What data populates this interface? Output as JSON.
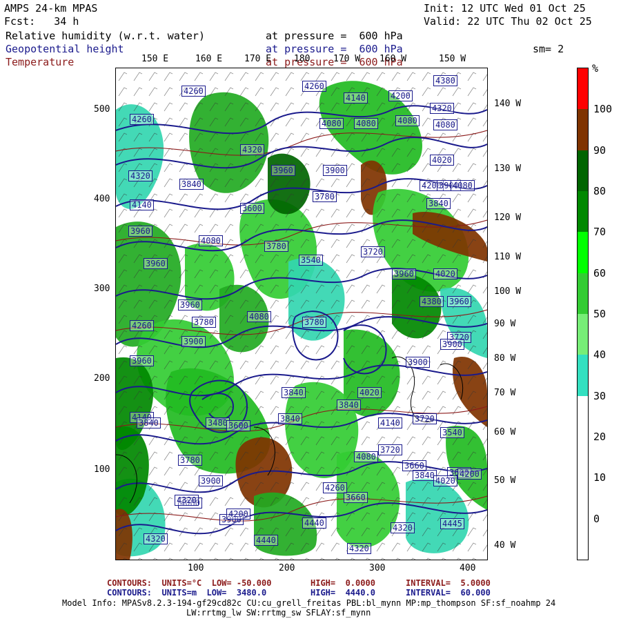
{
  "header": {
    "model": "AMPS 24-km MPAS",
    "init": "Init: 12 UTC Wed 01 Oct 25",
    "fcst": "Fcst:   34 h",
    "valid": "Valid: 22 UTC Thu 02 Oct 25",
    "field1": "Relative humidity (w.r.t. water)",
    "field1_level": "at pressure =  600 hPa",
    "field2": "Geopotential height",
    "field2_level": "at pressure =  600 hPa",
    "smoothing": "sm= 2",
    "field3": "Temperature",
    "field3_level": "at pressure =  600 hPa"
  },
  "map": {
    "top_lon_labels": [
      "150 E",
      "160 E",
      "170 E",
      "180",
      "170 W",
      "160 W",
      "150 W"
    ],
    "right_lon_labels": [
      "140 W",
      "130 W",
      "120 W",
      "110 W",
      "100 W",
      "90 W",
      "80 W",
      "70 W",
      "60 W",
      "50 W",
      "40 W"
    ],
    "left_grid_labels": [
      "500",
      "400",
      "300",
      "200",
      "100"
    ],
    "bottom_grid_labels": [
      "100",
      "200",
      "300",
      "400"
    ],
    "height_labels": [
      "4260",
      "4260",
      "4140",
      "4200",
      "4320",
      "4380",
      "4260",
      "4080",
      "4080",
      "4080",
      "4080",
      "4320",
      "4320",
      "4020",
      "4200",
      "3900",
      "3840",
      "3960",
      "3900",
      "3780",
      "4140",
      "3600",
      "3780",
      "3720",
      "3840",
      "4080",
      "3960",
      "3960",
      "3720",
      "4020",
      "3960",
      "4080",
      "3900",
      "3960",
      "3900",
      "3480",
      "3600",
      "3840",
      "4020",
      "3720",
      "3540",
      "3840",
      "3960",
      "3780",
      "4080",
      "3660",
      "3600",
      "3540",
      "4260",
      "3900",
      "3780",
      "3900",
      "3720",
      "3840",
      "3780",
      "3660",
      "3900",
      "4080",
      "3960",
      "4140",
      "3840",
      "4080",
      "4380",
      "4200",
      "4020",
      "4140",
      "4320",
      "4200",
      "4260",
      "4320",
      "4440",
      "4440",
      "4320",
      "4320",
      "4445",
      "3840"
    ]
  },
  "colorbar": {
    "unit": "%",
    "labels": [
      "100",
      "90",
      "80",
      "70",
      "60",
      "50",
      "40",
      "30",
      "20",
      "10",
      "0"
    ],
    "colors": [
      "#ff0000",
      "#7f3300",
      "#006400",
      "#008c00",
      "#00ff00",
      "#33d033",
      "#66ff66",
      "#33e0c0",
      "#ffffff",
      "#ffffff",
      "#ffffff",
      "#ffffff"
    ]
  },
  "footer": {
    "line1_a": "CONTOURS:  UNITS=°C  LOW= -50.000",
    "line1_b": "HIGH=  0.0000",
    "line1_c": "INTERVAL=  5.0000",
    "line2_a": "CONTOURS:  UNITS=m  LOW=  3480.0",
    "line2_b": "HIGH=  4440.0",
    "line2_c": "INTERVAL=  60.000",
    "model_info_1": "Model Info: MPASv8.2.3-194-gf29cd82c CU:cu_grell_freitas PBL:bl_mynn MP:mp_thompson SF:sf_noahmp 24",
    "model_info_2": "LW:rrtmg_lw SW:rrtmg_sw SFLAY:sf_mynn"
  }
}
